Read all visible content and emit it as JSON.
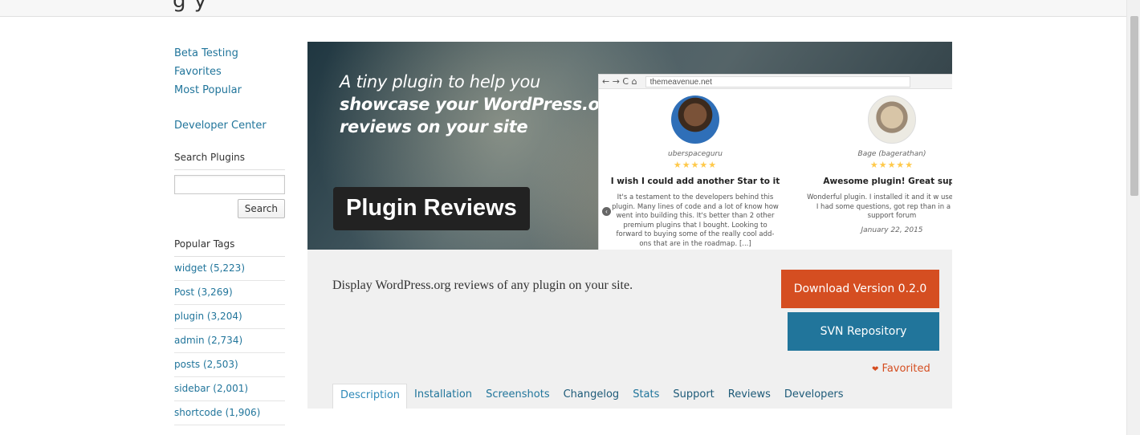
{
  "header": {
    "title_fragment": "g    y"
  },
  "sidebar": {
    "nav": [
      {
        "label": "Beta Testing"
      },
      {
        "label": "Favorites"
      },
      {
        "label": "Most Popular"
      }
    ],
    "developer_center": "Developer Center",
    "search": {
      "heading": "Search Plugins",
      "value": "",
      "button": "Search"
    },
    "popular_tags_heading": "Popular Tags",
    "tags": [
      {
        "label": "widget (5,223)"
      },
      {
        "label": "Post (3,269)"
      },
      {
        "label": "plugin (3,204)"
      },
      {
        "label": "admin (2,734)"
      },
      {
        "label": "posts (2,503)"
      },
      {
        "label": "sidebar (2,001)"
      },
      {
        "label": "shortcode (1,906)"
      }
    ]
  },
  "banner": {
    "tagline_line1": "A tiny plugin to help you",
    "tagline_line2": "showcase your WordPress.org",
    "tagline_line3": "reviews on your site",
    "badge": "Plugin Reviews",
    "mock_browser": {
      "nav_glyphs": "← → C ⌂",
      "url": "themeavenue.net",
      "reviews": [
        {
          "user": "uberspaceguru",
          "stars": "★★★★★",
          "title": "I wish I could add another Star to it",
          "body": "It's a testament to the developers behind this plugin. Many lines of code and a lot of know how went into building this. It's better than 2 other premium plugins that I bought. Looking to forward to buying some of the really cool add-ons that are in the roadmap. [...]"
        },
        {
          "user": "Bage (bagerathan)",
          "stars": "★★★★★",
          "title": "Awesome plugin! Great supp",
          "body": "Wonderful plugin. I installed it and it w use. When I had some questions, got rep than in a paid support forum",
          "date": "January 22, 2015"
        }
      ]
    }
  },
  "plugin": {
    "description": "Display WordPress.org reviews of any plugin on your site.",
    "download_label": "Download Version 0.2.0",
    "svn_label": "SVN Repository",
    "favorited_label": "Favorited"
  },
  "tabs": [
    {
      "label": "Description",
      "state": "active"
    },
    {
      "label": "Installation",
      "state": ""
    },
    {
      "label": "Screenshots",
      "state": ""
    },
    {
      "label": "Changelog",
      "state": "dark"
    },
    {
      "label": "Stats",
      "state": ""
    },
    {
      "label": "Support",
      "state": "dark"
    },
    {
      "label": "Reviews",
      "state": "dark"
    },
    {
      "label": "Developers",
      "state": "dark"
    }
  ],
  "colors": {
    "link": "#21759b",
    "download_button": "#d54e21",
    "svn_button": "#21759b",
    "favorited": "#d54e21",
    "star": "#ffc94a"
  }
}
